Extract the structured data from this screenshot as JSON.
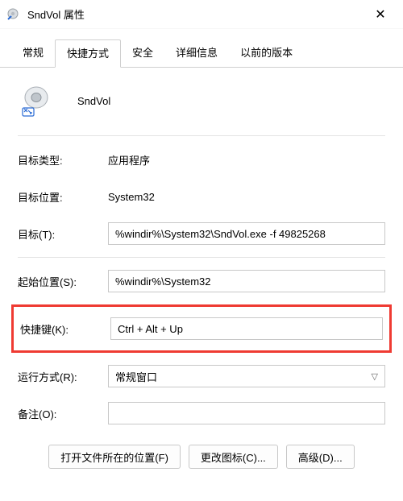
{
  "window": {
    "title": "SndVol 属性"
  },
  "tabs": {
    "general": "常规",
    "shortcut": "快捷方式",
    "security": "安全",
    "details": "详细信息",
    "previous": "以前的版本"
  },
  "app": {
    "name": "SndVol"
  },
  "fields": {
    "targetType": {
      "label": "目标类型:",
      "value": "应用程序"
    },
    "targetLocation": {
      "label": "目标位置:",
      "value": "System32"
    },
    "target": {
      "label": "目标(T):",
      "value": "%windir%\\System32\\SndVol.exe -f 49825268"
    },
    "startIn": {
      "label": "起始位置(S):",
      "value": "%windir%\\System32"
    },
    "shortcutKey": {
      "label": "快捷键(K):",
      "value": "Ctrl + Alt + Up"
    },
    "run": {
      "label": "运行方式(R):",
      "value": "常规窗口"
    },
    "comment": {
      "label": "备注(O):",
      "value": ""
    }
  },
  "buttons": {
    "openLocation": "打开文件所在的位置(F)",
    "changeIcon": "更改图标(C)...",
    "advanced": "高级(D)..."
  }
}
